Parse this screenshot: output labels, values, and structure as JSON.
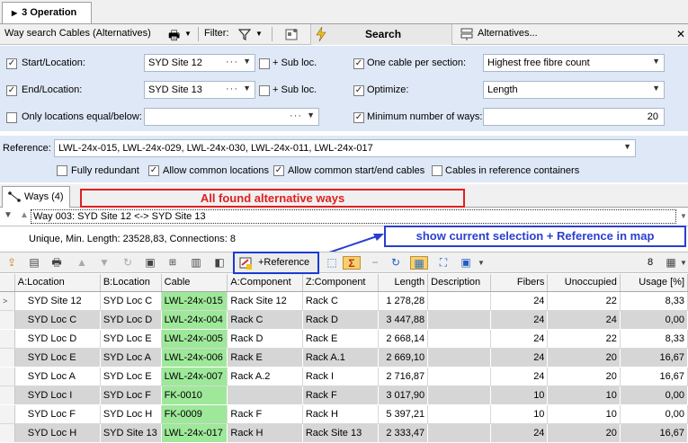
{
  "tab": {
    "title": "3 Operation"
  },
  "toolbar": {
    "title": "Way search Cables (Alternatives)",
    "filter_label": "Filter:",
    "search_label": "Search",
    "alternatives_label": "Alternatives...",
    "close": "✕"
  },
  "form": {
    "start_label": "Start/Location:",
    "start_value": "SYD Site 12",
    "sub_loc": "+ Sub loc.",
    "end_label": "End/Location:",
    "end_value": "SYD Site 13",
    "only_label": "Only locations equal/below:",
    "only_value": "",
    "one_cable_label": "One cable per section:",
    "one_cable_value": "Highest free fibre count",
    "optimize_label": "Optimize:",
    "optimize_value": "Length",
    "min_ways_label": "Minimum number of ways:",
    "min_ways_value": "20",
    "reference_label": "Reference:",
    "reference_value": "LWL-24x-015, LWL-24x-029, LWL-24x-030, LWL-24x-011, LWL-24x-017",
    "fully_redundant": "Fully redundant",
    "allow_common_locations": "Allow common locations",
    "allow_common_startend": "Allow common start/end cables",
    "cables_in_ref": "Cables in reference containers"
  },
  "ways": {
    "tab_label": "Ways (4)",
    "annotation": "All found alternative ways",
    "selected_way": "Way 003: SYD Site 12 <-> SYD Site 13",
    "info": "Unique, Min. Length: 23528,83, Connections: 8",
    "map_annotation": "show current selection + Reference in map"
  },
  "toolbar2": {
    "reference_label": "+Reference",
    "count": "8"
  },
  "table": {
    "columns": [
      "A:Location",
      "B:Location",
      "Cable",
      "A:Component",
      "Z:Component",
      "Length",
      "Description",
      "Fibers",
      "Unoccupied",
      "Usage [%]"
    ],
    "rows": [
      [
        "SYD Site 12",
        "SYD Loc C",
        "LWL-24x-015",
        "Rack Site 12",
        "Rack C",
        "1 278,28",
        "",
        "24",
        "22",
        "8,33"
      ],
      [
        "SYD Loc C",
        "SYD Loc D",
        "LWL-24x-004",
        "Rack C",
        "Rack D",
        "3 447,88",
        "",
        "24",
        "24",
        "0,00"
      ],
      [
        "SYD Loc D",
        "SYD Loc E",
        "LWL-24x-005",
        "Rack D",
        "Rack E",
        "2 668,14",
        "",
        "24",
        "22",
        "8,33"
      ],
      [
        "SYD Loc E",
        "SYD Loc A",
        "LWL-24x-006",
        "Rack E",
        "Rack A.1",
        "2 669,10",
        "",
        "24",
        "20",
        "16,67"
      ],
      [
        "SYD Loc A",
        "SYD Loc E",
        "LWL-24x-007",
        "Rack A.2",
        "Rack I",
        "2 716,87",
        "",
        "24",
        "20",
        "16,67"
      ],
      [
        "SYD Loc I",
        "SYD Loc F",
        "FK-0010",
        "",
        "Rack F",
        "3 017,90",
        "",
        "10",
        "10",
        "0,00"
      ],
      [
        "SYD Loc F",
        "SYD Loc H",
        "FK-0009",
        "Rack F",
        "Rack H",
        "5 397,21",
        "",
        "10",
        "10",
        "0,00"
      ],
      [
        "SYD Loc H",
        "SYD Site 13",
        "LWL-24x-017",
        "Rack H",
        "Rack Site 13",
        "2 333,47",
        "",
        "24",
        "20",
        "16,67"
      ]
    ]
  }
}
